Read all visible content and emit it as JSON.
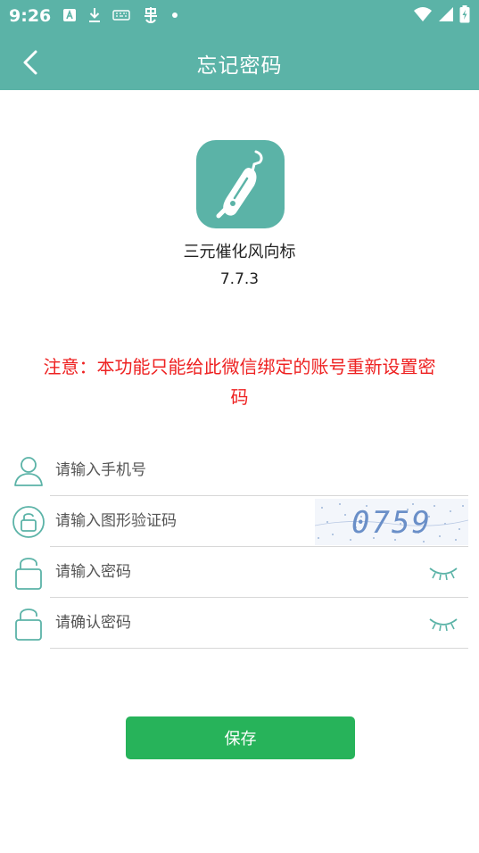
{
  "status_bar": {
    "time": "9:26"
  },
  "header": {
    "title": "忘记密码"
  },
  "app_info": {
    "name": "三元催化风向标",
    "version": "7.7.3"
  },
  "notice": "注意：本功能只能给此微信绑定的账号重新设置密码",
  "form": {
    "phone_placeholder": "请输入手机号",
    "captcha_placeholder": "请输入图形验证码",
    "captcha_text": "0759",
    "password_placeholder": "请输入密码",
    "confirm_placeholder": "请确认密码"
  },
  "save_label": "保存",
  "colors": {
    "theme": "#5bb3a7",
    "notice": "#ee2222",
    "save_button": "#27b35a"
  }
}
